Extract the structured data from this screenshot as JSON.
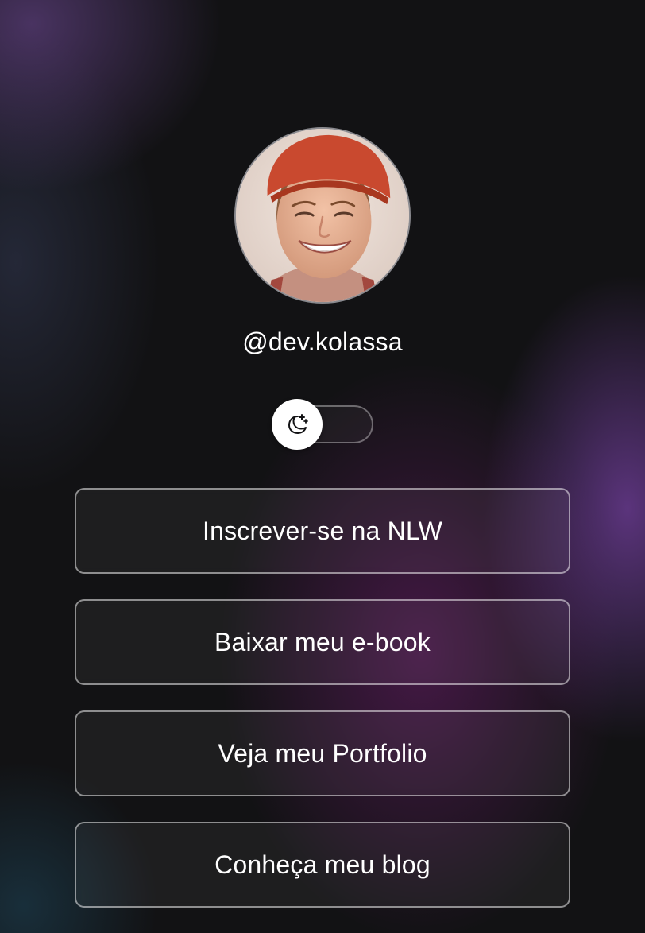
{
  "profile": {
    "avatar_description_icon": "avatar-photo",
    "username": "@dev.kolassa"
  },
  "theme_switch": {
    "icon": "moon-stars-icon",
    "state": "dark"
  },
  "links": [
    {
      "label": "Inscrever-se na NLW"
    },
    {
      "label": "Baixar meu e-book"
    },
    {
      "label": "Veja meu Portfolio"
    },
    {
      "label": "Conheça meu blog"
    }
  ],
  "colors": {
    "background": "#121214",
    "text": "#ffffff",
    "accent_purple": "#8246b4",
    "button_border": "#8a8a8f"
  }
}
